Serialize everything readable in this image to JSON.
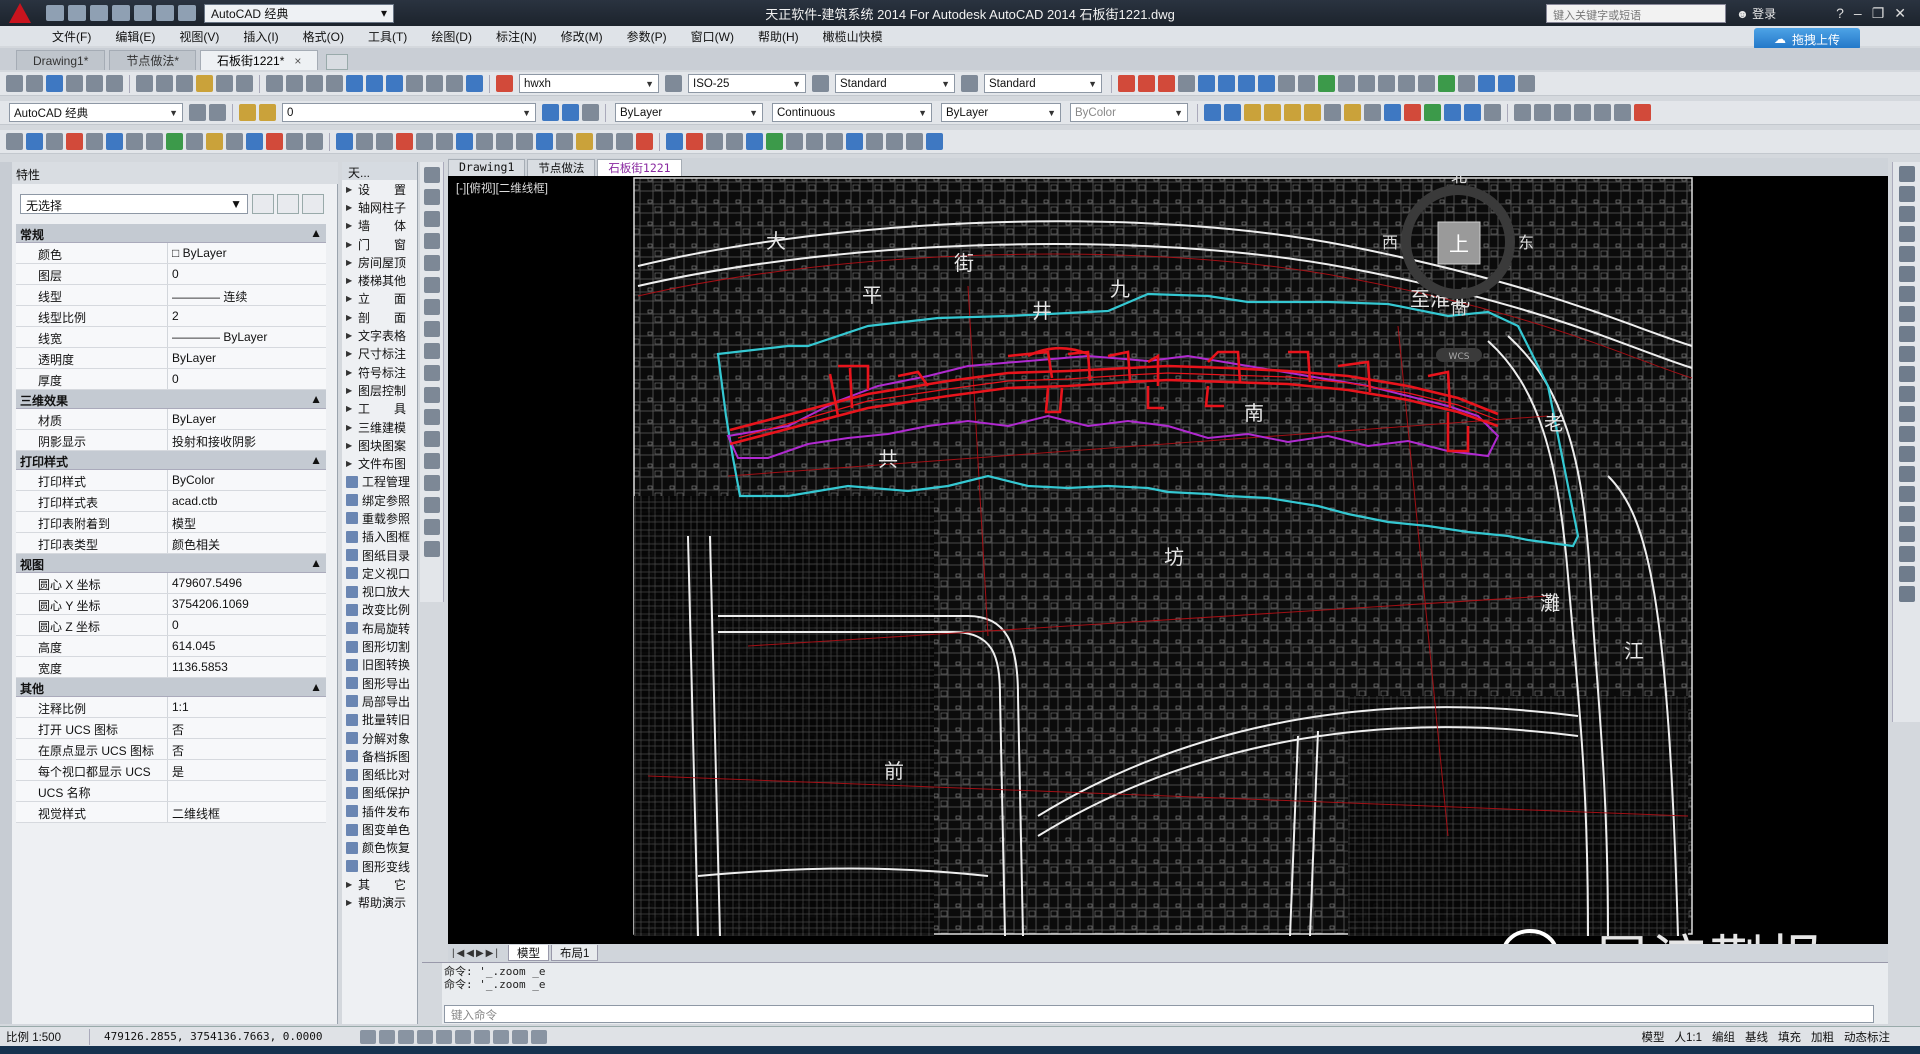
{
  "titlebar": {
    "workspace": "AutoCAD 经典",
    "title": "天正软件-建筑系统 2014  For Autodesk AutoCAD 2014    石板街1221.dwg",
    "search_placeholder": "键入关键字或短语",
    "login": "登录"
  },
  "menu": [
    "文件(F)",
    "编辑(E)",
    "视图(V)",
    "插入(I)",
    "格式(O)",
    "工具(T)",
    "绘图(D)",
    "标注(N)",
    "修改(M)",
    "参数(P)",
    "窗口(W)",
    "帮助(H)",
    "橄榄山快模"
  ],
  "upload_label": "拖拽上传",
  "doc_tabs": [
    {
      "label": "Drawing1*",
      "active": false
    },
    {
      "label": "节点做法*",
      "active": false
    },
    {
      "label": "石板街1221*",
      "active": true
    }
  ],
  "toolbar": {
    "text_style": "hwxh",
    "dim_style": "ISO-25",
    "table_style": "Standard",
    "mleader_style": "Standard",
    "workspace2": "AutoCAD 经典",
    "layer": "0",
    "color": "ByLayer",
    "linetype": "Continuous",
    "lineweight": "ByLayer",
    "plotstyle": "ByColor"
  },
  "properties": {
    "title": "特性",
    "selection": "无选择",
    "sections": [
      {
        "name": "常规",
        "rows": [
          {
            "k": "颜色",
            "v": "□ ByLayer"
          },
          {
            "k": "图层",
            "v": "0"
          },
          {
            "k": "线型",
            "v": "———— 连续"
          },
          {
            "k": "线型比例",
            "v": "2"
          },
          {
            "k": "线宽",
            "v": "———— ByLayer"
          },
          {
            "k": "透明度",
            "v": "ByLayer"
          },
          {
            "k": "厚度",
            "v": "0"
          }
        ]
      },
      {
        "name": "三维效果",
        "rows": [
          {
            "k": "材质",
            "v": "ByLayer"
          },
          {
            "k": "阴影显示",
            "v": "投射和接收阴影"
          }
        ]
      },
      {
        "name": "打印样式",
        "rows": [
          {
            "k": "打印样式",
            "v": "ByColor"
          },
          {
            "k": "打印样式表",
            "v": "acad.ctb"
          },
          {
            "k": "打印表附着到",
            "v": "模型"
          },
          {
            "k": "打印表类型",
            "v": "颜色相关"
          }
        ]
      },
      {
        "name": "视图",
        "rows": [
          {
            "k": "圆心 X 坐标",
            "v": "479607.5496"
          },
          {
            "k": "圆心 Y 坐标",
            "v": "3754206.1069"
          },
          {
            "k": "圆心 Z 坐标",
            "v": "0"
          },
          {
            "k": "高度",
            "v": "614.045"
          },
          {
            "k": "宽度",
            "v": "1136.5853"
          }
        ]
      },
      {
        "name": "其他",
        "rows": [
          {
            "k": "注释比例",
            "v": "1:1"
          },
          {
            "k": "打开 UCS 图标",
            "v": "否"
          },
          {
            "k": "在原点显示 UCS 图标",
            "v": "否"
          },
          {
            "k": "每个视口都显示 UCS",
            "v": "是"
          },
          {
            "k": "UCS 名称",
            "v": ""
          },
          {
            "k": "视觉样式",
            "v": "二维线框"
          }
        ]
      }
    ]
  },
  "tangent_palette": {
    "title": "天...",
    "items": [
      "设　　置",
      "轴网柱子",
      "墙　　体",
      "门　　窗",
      "房间屋顶",
      "楼梯其他",
      "立　　面",
      "剖　　面",
      "文字表格",
      "尺寸标注",
      "符号标注",
      "图层控制",
      "工　　具",
      "三维建模",
      "图块图案",
      "文件布图",
      "工程管理",
      "绑定参照",
      "重载参照",
      "插入图框",
      "图纸目录",
      "定义视口",
      "视口放大",
      "改变比例",
      "布局旋转",
      "图形切割",
      "旧图转换",
      "图形导出",
      "局部导出",
      "批量转旧",
      "分解对象",
      "备档拆图",
      "图纸比对",
      "图纸保护",
      "插件发布",
      "图变单色",
      "颜色恢复",
      "图形变线",
      "其　　它",
      "帮助演示"
    ]
  },
  "view_tabs": [
    {
      "label": "Drawing1",
      "active": false
    },
    {
      "label": "节点做法",
      "active": false
    },
    {
      "label": "石板街1221",
      "active": true
    }
  ],
  "viewport_label": "[-][俯视][二维线框]",
  "map_labels": [
    "大",
    "街",
    "平",
    "九",
    "至淮北",
    "老",
    "井",
    "南",
    "共",
    "坊",
    "灘",
    "江",
    "前"
  ],
  "compass": {
    "north": "北",
    "south": "南",
    "east": "东",
    "west": "西",
    "center": "上",
    "wcs": "WCS"
  },
  "layout_tabs": [
    {
      "label": "模型",
      "active": true
    },
    {
      "label": "布局1",
      "active": false
    }
  ],
  "command": {
    "history": [
      "命令: '_.zoom _e",
      "命令: '_.zoom _e"
    ],
    "placeholder": "键入命令"
  },
  "status": {
    "scale": "比例 1:500",
    "coords": "479126.2855, 3754136.7663, 0.0000",
    "right_items": [
      "模型",
      "人1:1",
      "编组",
      "基线",
      "填充",
      "加粗",
      "动态标注"
    ]
  },
  "watermark": "犀流蒯报",
  "colors": {
    "boundary_cyan": "#35c8d2",
    "street_red": "#e8141c",
    "purple": "#b02ad0",
    "canvas_bg": "#000000"
  }
}
